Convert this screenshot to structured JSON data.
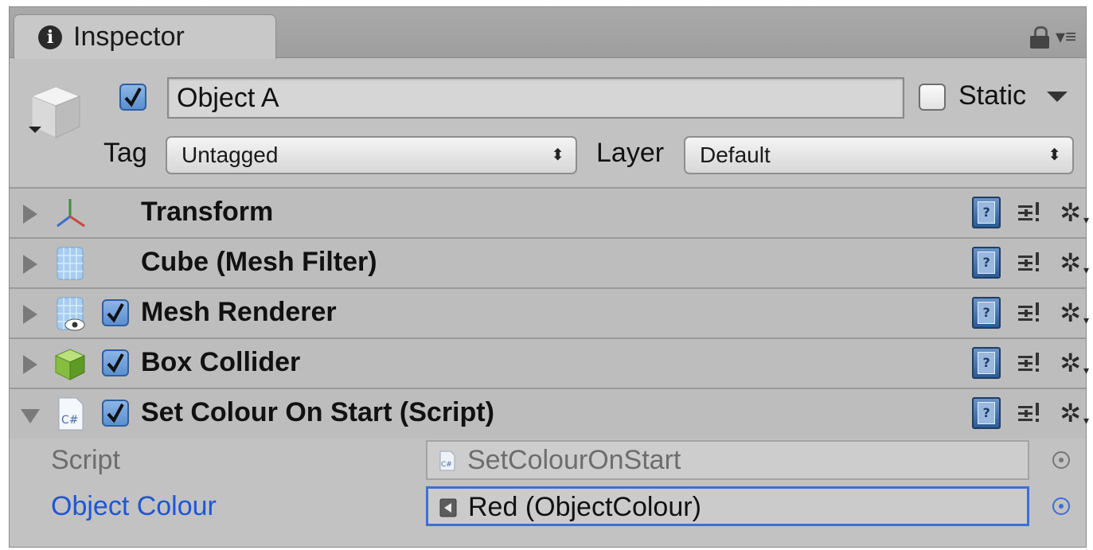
{
  "tab": {
    "title": "Inspector"
  },
  "object": {
    "name": "Object A",
    "active": true,
    "static_label": "Static",
    "static": false,
    "tag_label": "Tag",
    "tag_value": "Untagged",
    "layer_label": "Layer",
    "layer_value": "Default"
  },
  "components": [
    {
      "title": "Transform",
      "icon": "transform-axes-icon",
      "has_toggle": false,
      "expanded": false
    },
    {
      "title": "Cube (Mesh Filter)",
      "icon": "mesh-filter-icon",
      "has_toggle": false,
      "expanded": false
    },
    {
      "title": "Mesh Renderer",
      "icon": "mesh-renderer-icon",
      "has_toggle": true,
      "enabled": true,
      "expanded": false
    },
    {
      "title": "Box Collider",
      "icon": "box-collider-icon",
      "has_toggle": true,
      "enabled": true,
      "expanded": false
    },
    {
      "title": "Set Colour On Start (Script)",
      "icon": "csharp-script-icon",
      "has_toggle": true,
      "enabled": true,
      "expanded": true
    }
  ],
  "script_fields": {
    "script_label": "Script",
    "script_value": "SetColourOnStart",
    "colour_label": "Object Colour",
    "colour_value": "Red (ObjectColour)"
  },
  "colors": {
    "accent": "#3c6fd8",
    "label_blue": "#1e56d6",
    "panel": "#c2c2c2",
    "tabbar": "#a3a3a3"
  }
}
